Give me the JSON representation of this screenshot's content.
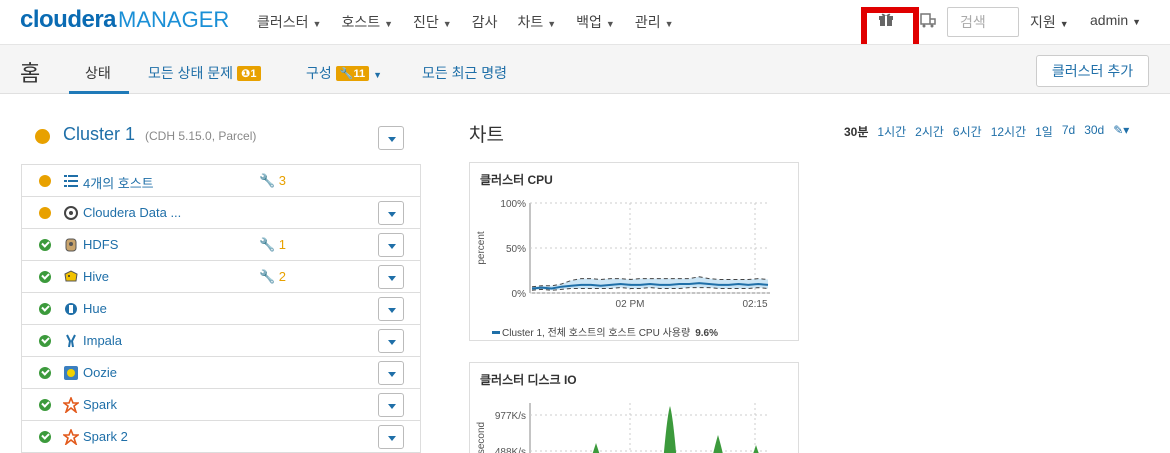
{
  "brand": {
    "name": "cloudera",
    "product": "MANAGER"
  },
  "menu": [
    {
      "label": "클러스터",
      "caret": true
    },
    {
      "label": "호스트",
      "caret": true
    },
    {
      "label": "진단",
      "caret": true
    },
    {
      "label": "감사",
      "caret": false
    },
    {
      "label": "차트",
      "caret": true
    },
    {
      "label": "백업",
      "caret": true
    },
    {
      "label": "관리",
      "caret": true
    }
  ],
  "search": {
    "placeholder": "검색"
  },
  "support_label": "지원",
  "user_label": "admin",
  "subnav": {
    "home": "홈",
    "tabs": {
      "status": "상태",
      "all_issues": "모든 상태 문제",
      "all_issues_badge": "1",
      "config": "구성",
      "config_badge": "11",
      "recent_commands": "모든 최근 명령"
    },
    "add_cluster": "클러스터 추가"
  },
  "cluster": {
    "name": "Cluster 1",
    "meta": "(CDH 5.15.0, Parcel)",
    "status_color": "#e8a100"
  },
  "services": [
    {
      "name": "4개의 호스트",
      "status": "warn",
      "icon": "list-icon",
      "wrench": "3",
      "dropdown": false
    },
    {
      "name": "Cloudera Data ...",
      "status": "warn",
      "icon": "cloudera-data-icon",
      "wrench": "",
      "dropdown": true
    },
    {
      "name": "HDFS",
      "status": "ok",
      "icon": "hdfs-icon",
      "wrench": "1",
      "dropdown": true
    },
    {
      "name": "Hive",
      "status": "ok",
      "icon": "hive-icon",
      "wrench": "2",
      "dropdown": true
    },
    {
      "name": "Hue",
      "status": "ok",
      "icon": "hue-icon",
      "wrench": "",
      "dropdown": true
    },
    {
      "name": "Impala",
      "status": "ok",
      "icon": "impala-icon",
      "wrench": "",
      "dropdown": true
    },
    {
      "name": "Oozie",
      "status": "ok",
      "icon": "oozie-icon",
      "wrench": "",
      "dropdown": true
    },
    {
      "name": "Spark",
      "status": "ok",
      "icon": "spark-icon",
      "wrench": "",
      "dropdown": true
    },
    {
      "name": "Spark 2",
      "status": "ok",
      "icon": "spark-icon",
      "wrench": "",
      "dropdown": true
    }
  ],
  "charts_section": {
    "title": "차트",
    "ranges": [
      "30분",
      "1시간",
      "2시간",
      "6시간",
      "12시간",
      "1일",
      "7d",
      "30d"
    ],
    "active_range": "30분"
  },
  "chart_data": [
    {
      "type": "line",
      "title": "클러스터 CPU",
      "ylabel": "percent",
      "ytick_labels": [
        "100%",
        "50%",
        "0%"
      ],
      "xtick_labels": [
        "02 PM",
        "02:15"
      ],
      "ylim": [
        0,
        100
      ],
      "series": [
        {
          "name": "Cluster 1, 전체 호스트의 호스트 CPU 사용량",
          "last_value": "9.6%",
          "values": [
            5,
            6,
            5,
            7,
            8,
            9,
            9,
            8,
            9,
            10,
            9,
            9,
            10,
            9,
            9,
            10,
            10,
            11,
            10,
            9,
            9,
            10,
            9,
            10,
            9
          ]
        }
      ],
      "band_upper": [
        7,
        8,
        8,
        10,
        14,
        16,
        16,
        15,
        16,
        16,
        15,
        16,
        16,
        16,
        16,
        16,
        16,
        18,
        16,
        15,
        15,
        15,
        15,
        16,
        15
      ],
      "band_lower": [
        3,
        4,
        3,
        4,
        5,
        5,
        5,
        5,
        5,
        6,
        5,
        5,
        6,
        5,
        5,
        5,
        6,
        6,
        6,
        5,
        5,
        5,
        5,
        6,
        5
      ]
    },
    {
      "type": "area",
      "title": "클러스터 디스크 IO",
      "ylabel": "second",
      "ytick_labels": [
        "977K/s",
        "488K/s"
      ],
      "color": "#3c9a3c"
    }
  ]
}
